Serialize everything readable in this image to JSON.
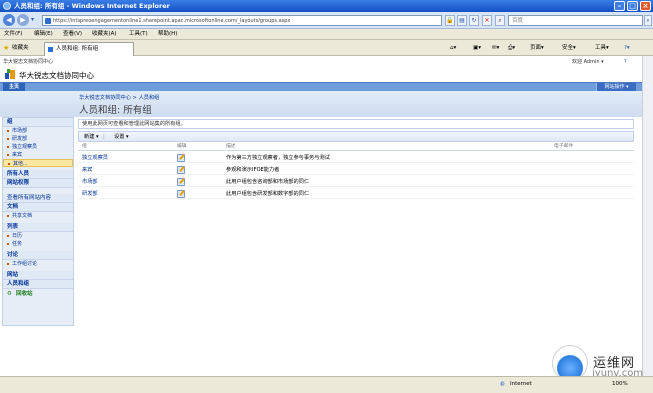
{
  "browser": {
    "title": "人员和组: 所有组 - Windows Internet Explorer",
    "url": "https://intspreoengagementonline1.sharepoint.apac.microsoftonline.com/_layouts/groups.aspx",
    "search_placeholder": "百度",
    "menu": [
      "文件(F)",
      "编辑(E)",
      "查看(V)",
      "收藏夹(A)",
      "工具(T)",
      "帮助(H)"
    ],
    "favorites_label": "收藏夹",
    "tab_title": "人员和组: 所有组",
    "commands": {
      "page": "页面",
      "safety": "安全",
      "tools": "工具"
    },
    "status": {
      "zone": "Internet",
      "zoom": "100%"
    }
  },
  "site": {
    "site_name_small": "华大锐志文档协同中心",
    "welcome": "欢迎 Admin",
    "site_title": "华大锐志文档协同中心",
    "home_tab": "主页",
    "site_actions": "网站操作",
    "breadcrumb_root": "华大锐志文档协同中心",
    "breadcrumb_sep": ">",
    "breadcrumb_current": "人员和组",
    "page_title": "人员和组:  所有组"
  },
  "quick_launch": {
    "groups_heading": "组",
    "groups": [
      "市场部",
      "研发部",
      "独立观察员",
      "来宾",
      "其他..."
    ],
    "people": "所有人员",
    "permissions": "网站权限",
    "view_all": "查看所有网站内容",
    "documents_heading": "文档",
    "documents": [
      "共享文档"
    ],
    "lists_heading": "列表",
    "lists": [
      "日历",
      "任务"
    ],
    "discussions_heading": "讨论",
    "discussions": [
      "工作组讨论"
    ],
    "sites_heading": "网站",
    "people_groups_heading": "人员和组",
    "recycle_bin": "回收站"
  },
  "main": {
    "description": "使用此网页可查看和管理此网站集的所有组。",
    "toolbar": {
      "new": "新建",
      "settings": "设置"
    },
    "columns": {
      "group": "组",
      "edit": "编辑",
      "about": "描述",
      "email": "电子邮件"
    },
    "rows": [
      {
        "name": "独立观察员",
        "about": "作为第三方独立观察者，独立参与事务与测试"
      },
      {
        "name": "来宾",
        "about": "参观和演示IFOE能力者"
      },
      {
        "name": "市场部",
        "about": "此用户组包含咨询部和市场部的同仁"
      },
      {
        "name": "研发部",
        "about": "此用户组包含研发部和数字部的同仁"
      }
    ]
  },
  "watermark": {
    "brand": "运维网",
    "domain": "iyunv.com"
  }
}
